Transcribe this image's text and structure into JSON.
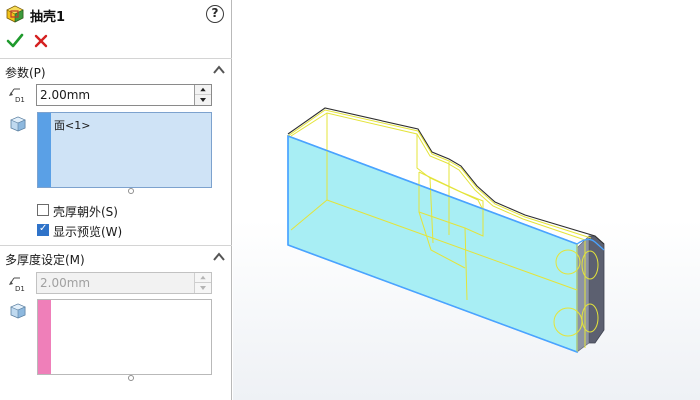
{
  "property_manager": {
    "title": "抽壳1",
    "help_glyph": "?",
    "ok_icon": "checkmark-icon",
    "cancel_icon": "x-icon",
    "parameters": {
      "header": "参数(P)",
      "thickness_value": "2.00mm",
      "faces_to_remove": [
        "面<1>"
      ],
      "shell_outward_label": "壳厚朝外(S)",
      "shell_outward_checked": false,
      "show_preview_label": "显示预览(W)",
      "show_preview_checked": true,
      "stripe_color": "#5aa0e6"
    },
    "multi_thickness": {
      "header": "多厚度设定(M)",
      "thickness_value": "2.00mm",
      "faces": [],
      "stripe_color": "#ef7fb9"
    }
  },
  "viewport": {
    "face_fill_color": "#a8eef4",
    "edge_preview_color": "#e4e43a",
    "selection_edge_color": "#4aa3ff"
  }
}
